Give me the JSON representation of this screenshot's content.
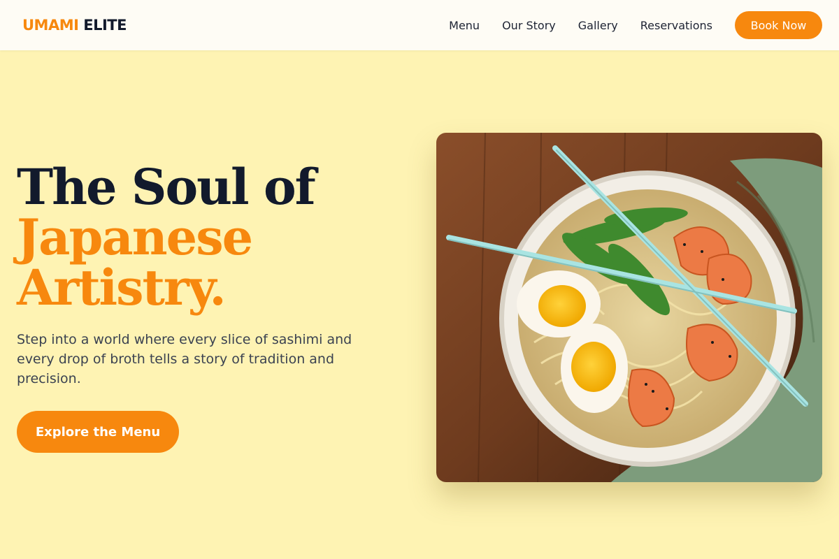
{
  "nav": {
    "logo_primary": "UMAMI",
    "logo_secondary": "ELITE",
    "links": [
      "Menu",
      "Our Story",
      "Gallery",
      "Reservations"
    ],
    "cta_label": "Book Now"
  },
  "hero": {
    "title_line1": "The Soul of",
    "title_line2": "Japanese",
    "title_line3": "Artistry.",
    "subtitle": "Step into a world where every slice of sashimi and every drop of broth tells a story of tradition and precision.",
    "cta_label": "Explore the Menu",
    "image_subject": "ramen bowl with eggs, shrimp, snap peas and chopsticks"
  },
  "colors": {
    "accent": "#f7880e",
    "page_background": "#fef3b3",
    "header_background": "#fefcf5",
    "heading_dark": "#121a2c",
    "body_text": "#3b4251"
  }
}
